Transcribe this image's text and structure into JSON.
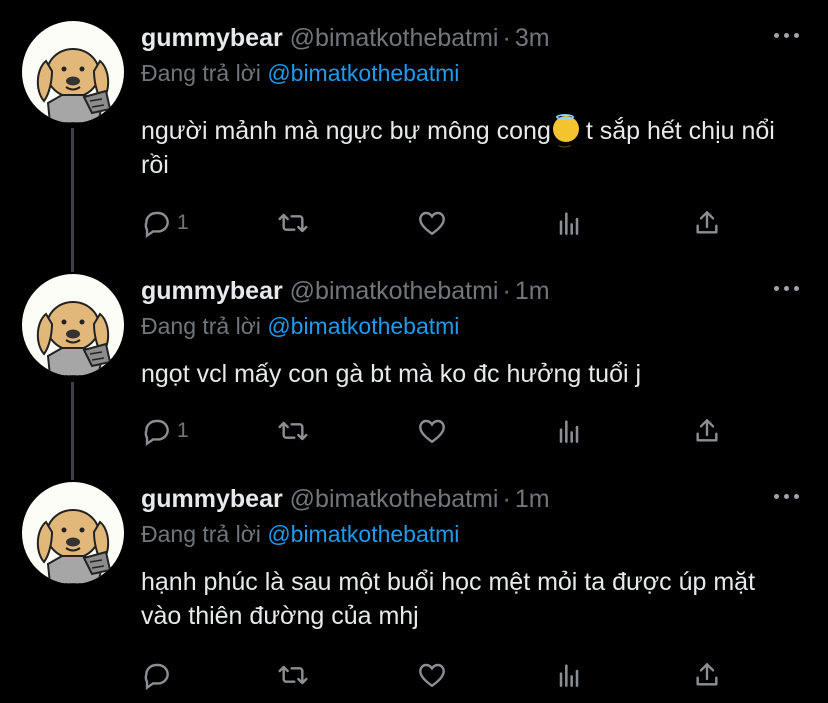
{
  "tweets": [
    {
      "name": "gummybear",
      "handle": "@bimatkothebatmi",
      "separator": "·",
      "time": "3m",
      "reply_label": "Đang trả lời",
      "reply_to": "@bimatkothebatmi",
      "text_before_emoji": "người mảnh mà ngực bự mông cong",
      "emoji_icon": "smiling-face-with-halo",
      "text_after_emoji": " t sắp hết chịu nổi rồi",
      "reply_count": "1"
    },
    {
      "name": "gummybear",
      "handle": "@bimatkothebatmi",
      "separator": "·",
      "time": "1m",
      "reply_label": "Đang trả lời",
      "reply_to": "@bimatkothebatmi",
      "text": "ngọt vcl mấy con gà bt mà ko đc hưởng tuổi j",
      "reply_count": "1"
    },
    {
      "name": "gummybear",
      "handle": "@bimatkothebatmi",
      "separator": "·",
      "time": "1m",
      "reply_label": "Đang trả lời",
      "reply_to": "@bimatkothebatmi",
      "text": "hạnh phúc là sau một buổi học mệt mỏi ta được úp mặt vào thiên đường của mhj",
      "reply_count": ""
    }
  ],
  "colors": {
    "background": "#000000",
    "text": "#e7e9ea",
    "muted": "#71767b",
    "accent": "#1d9bf0",
    "thread_line": "#3d4147"
  },
  "icons": {
    "more": "more-horizontal-icon",
    "reply": "reply-bubble-icon",
    "retweet": "retweet-icon",
    "like": "heart-icon",
    "analytics": "analytics-icon",
    "share": "share-icon"
  }
}
